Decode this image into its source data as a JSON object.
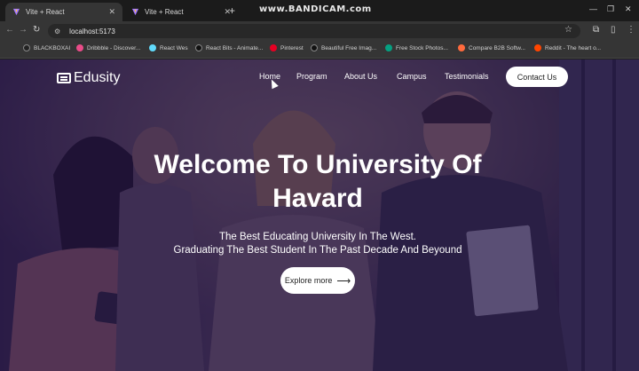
{
  "browser": {
    "tabs": [
      {
        "label": "Vite + React",
        "active": true
      },
      {
        "label": "Vite + React",
        "active": false
      }
    ],
    "new_tab_icon": "+",
    "recorder_watermark": "www.BANDICAM.com",
    "window_controls": [
      "—",
      "❐",
      "✕"
    ],
    "url": "localhost:5173",
    "bookmarks": [
      {
        "label": "BLACKBOXAI",
        "color": "#222222"
      },
      {
        "label": "Dribbble - Discover...",
        "color": "#ea4c89"
      },
      {
        "label": "React Wes",
        "color": "#61dafb"
      },
      {
        "label": "React Bits - Animate...",
        "color": "#111111"
      },
      {
        "label": "Pinterest",
        "color": "#e60023"
      },
      {
        "label": "Beautiful Free Imag...",
        "color": "#111111"
      },
      {
        "label": "Free Stock Photos...",
        "color": "#05a081"
      },
      {
        "label": "Compare B2B Softw...",
        "color": "#ff6a3d"
      },
      {
        "label": "Reddit - The heart o...",
        "color": "#ff4500"
      }
    ]
  },
  "site": {
    "logo": "Edusity",
    "nav": [
      "Home",
      "Program",
      "About Us",
      "Campus",
      "Testimonials"
    ],
    "contact_label": "Contact Us"
  },
  "hero": {
    "title_line1": "Welcome To University Of",
    "title_line2": "Havard",
    "subtitle_line1": "The Best Educating University In The West.",
    "subtitle_line2": "Graduating The Best Student In The Past Decade And Beyound",
    "cta_label": "Explore more",
    "cta_arrow": "⟶"
  },
  "colors": {
    "overlay": "#221248",
    "button_bg": "#ffffff",
    "button_text": "#212121"
  }
}
